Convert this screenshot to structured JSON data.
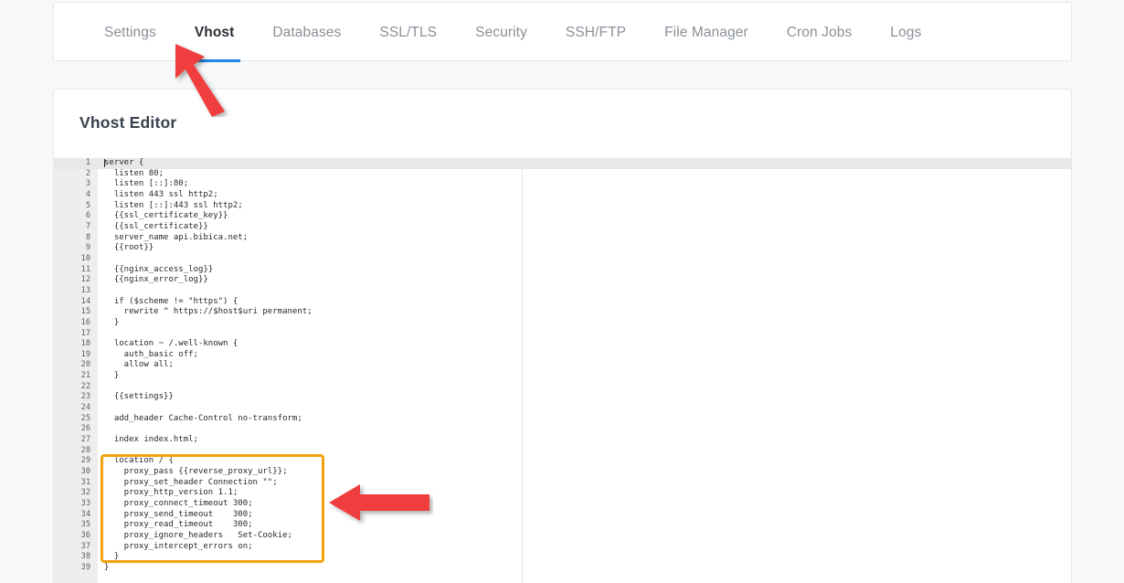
{
  "tabs": [
    {
      "label": "Settings",
      "active": false
    },
    {
      "label": "Vhost",
      "active": true
    },
    {
      "label": "Databases",
      "active": false
    },
    {
      "label": "SSL/TLS",
      "active": false
    },
    {
      "label": "Security",
      "active": false
    },
    {
      "label": "SSH/FTP",
      "active": false
    },
    {
      "label": "File Manager",
      "active": false
    },
    {
      "label": "Cron Jobs",
      "active": false
    },
    {
      "label": "Logs",
      "active": false
    }
  ],
  "editor": {
    "title": "Vhost Editor",
    "active_line": 1,
    "total_lines": 39,
    "language": "nginx",
    "lines": [
      {
        "n": 1,
        "text": "server {"
      },
      {
        "n": 2,
        "text": "  listen 80;"
      },
      {
        "n": 3,
        "text": "  listen [::]:80;"
      },
      {
        "n": 4,
        "text": "  listen 443 ssl http2;"
      },
      {
        "n": 5,
        "text": "  listen [::]:443 ssl http2;"
      },
      {
        "n": 6,
        "text": "  {{ssl_certificate_key}}"
      },
      {
        "n": 7,
        "text": "  {{ssl_certificate}}"
      },
      {
        "n": 8,
        "text": "  server_name api.bibica.net;"
      },
      {
        "n": 9,
        "text": "  {{root}}"
      },
      {
        "n": 10,
        "text": ""
      },
      {
        "n": 11,
        "text": "  {{nginx_access_log}}"
      },
      {
        "n": 12,
        "text": "  {{nginx_error_log}}"
      },
      {
        "n": 13,
        "text": ""
      },
      {
        "n": 14,
        "text": "  if ($scheme != \"https\") {"
      },
      {
        "n": 15,
        "text": "    rewrite ^ https://$host$uri permanent;"
      },
      {
        "n": 16,
        "text": "  }"
      },
      {
        "n": 17,
        "text": ""
      },
      {
        "n": 18,
        "text": "  location ~ /.well-known {"
      },
      {
        "n": 19,
        "text": "    auth_basic off;"
      },
      {
        "n": 20,
        "text": "    allow all;"
      },
      {
        "n": 21,
        "text": "  }"
      },
      {
        "n": 22,
        "text": ""
      },
      {
        "n": 23,
        "text": "  {{settings}}"
      },
      {
        "n": 24,
        "text": ""
      },
      {
        "n": 25,
        "text": "  add_header Cache-Control no-transform;"
      },
      {
        "n": 26,
        "text": ""
      },
      {
        "n": 27,
        "text": "  index index.html;"
      },
      {
        "n": 28,
        "text": ""
      },
      {
        "n": 29,
        "text": "  location / {"
      },
      {
        "n": 30,
        "text": "    proxy_pass {{reverse_proxy_url}};"
      },
      {
        "n": 31,
        "text": "    proxy_set_header Connection \"\";"
      },
      {
        "n": 32,
        "text": "    proxy_http_version 1.1;"
      },
      {
        "n": 33,
        "text": "    proxy_connect_timeout 300;"
      },
      {
        "n": 34,
        "text": "    proxy_send_timeout    300;"
      },
      {
        "n": 35,
        "text": "    proxy_read_timeout    300;"
      },
      {
        "n": 36,
        "text": "    proxy_ignore_headers   Set-Cookie;"
      },
      {
        "n": 37,
        "text": "    proxy_intercept_errors on;"
      },
      {
        "n": 38,
        "text": "  }"
      },
      {
        "n": 39,
        "text": "}"
      }
    ]
  },
  "annotations": {
    "highlight_color": "#f2a30f",
    "arrow_color": "#f03c3c",
    "highlight_lines": "29-38",
    "arrows": [
      {
        "name": "tab-pointer",
        "target": "Vhost"
      },
      {
        "name": "proxy-block-pointer",
        "target": "location / block"
      }
    ]
  },
  "colors": {
    "accent": "#1e88e5",
    "page_background": "#f6f8fa",
    "card_background": "#ffffff",
    "gutter_background": "#eeeeee",
    "active_line_background": "#e8e8e8"
  }
}
